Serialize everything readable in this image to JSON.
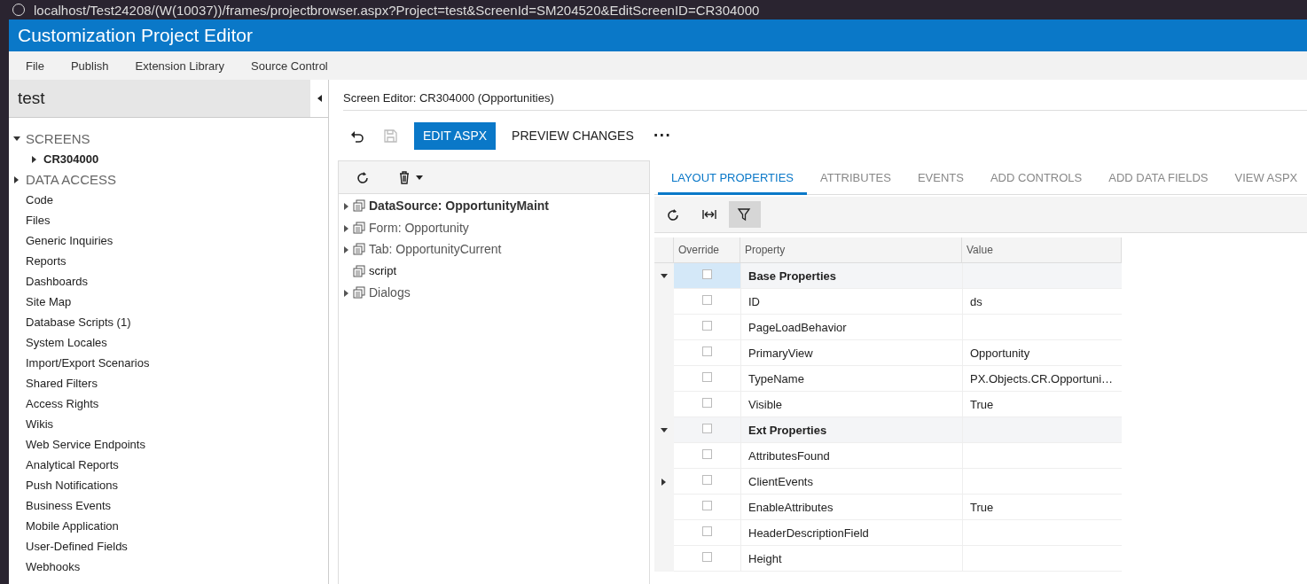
{
  "browser": {
    "address": "localhost/Test24208/(W(10037))/frames/projectbrowser.aspx?Project=test&ScreenId=SM204520&EditScreenID=CR304000"
  },
  "app_title": "Customization Project Editor",
  "menu": [
    "File",
    "Publish",
    "Extension Library",
    "Source Control"
  ],
  "sidebar": {
    "project": "test",
    "items": [
      {
        "label": "SCREENS",
        "kind": "section",
        "expanded": true,
        "children": [
          {
            "label": "CR304000",
            "kind": "node",
            "expanded": false
          }
        ]
      },
      {
        "label": "DATA ACCESS",
        "kind": "section",
        "expanded": false
      },
      {
        "label": "Code",
        "kind": "item"
      },
      {
        "label": "Files",
        "kind": "item"
      },
      {
        "label": "Generic Inquiries",
        "kind": "item"
      },
      {
        "label": "Reports",
        "kind": "item"
      },
      {
        "label": "Dashboards",
        "kind": "item"
      },
      {
        "label": "Site Map",
        "kind": "item"
      },
      {
        "label": "Database Scripts (1)",
        "kind": "item"
      },
      {
        "label": "System Locales",
        "kind": "item"
      },
      {
        "label": "Import/Export Scenarios",
        "kind": "item"
      },
      {
        "label": "Shared Filters",
        "kind": "item"
      },
      {
        "label": "Access Rights",
        "kind": "item"
      },
      {
        "label": "Wikis",
        "kind": "item"
      },
      {
        "label": "Web Service Endpoints",
        "kind": "item"
      },
      {
        "label": "Analytical Reports",
        "kind": "item"
      },
      {
        "label": "Push Notifications",
        "kind": "item"
      },
      {
        "label": "Business Events",
        "kind": "item"
      },
      {
        "label": "Mobile Application",
        "kind": "item"
      },
      {
        "label": "User-Defined Fields",
        "kind": "item"
      },
      {
        "label": "Webhooks",
        "kind": "item"
      }
    ]
  },
  "editor": {
    "title": "Screen Editor: CR304000 (Opportunities)",
    "toolbar": [
      {
        "kind": "undo",
        "disabled": false
      },
      {
        "kind": "save",
        "disabled": true
      },
      {
        "kind": "primary",
        "label": "EDIT ASPX"
      },
      {
        "kind": "text",
        "label": "PREVIEW CHANGES"
      },
      {
        "kind": "more",
        "label": "···"
      }
    ],
    "controls_tree": [
      {
        "label": "DataSource: OpportunityMaint",
        "kind": "bold",
        "expandable": true
      },
      {
        "label": "Form: Opportunity",
        "kind": "normal",
        "expandable": true
      },
      {
        "label": "Tab: OpportunityCurrent",
        "kind": "normal",
        "expandable": true
      },
      {
        "label": "script",
        "kind": "dark",
        "expandable": false
      },
      {
        "label": "Dialogs",
        "kind": "normal",
        "expandable": true
      }
    ],
    "tabs": [
      {
        "label": "LAYOUT PROPERTIES",
        "selected": true
      },
      {
        "label": "ATTRIBUTES",
        "selected": false
      },
      {
        "label": "EVENTS",
        "selected": false
      },
      {
        "label": "ADD CONTROLS",
        "selected": false
      },
      {
        "label": "ADD DATA FIELDS",
        "selected": false
      },
      {
        "label": "VIEW ASPX",
        "selected": false
      }
    ],
    "grid_toolbar": {
      "filter_on": true
    },
    "columns": [
      "Override",
      "Property",
      "Value"
    ],
    "rows": [
      {
        "kind": "group",
        "property": "Base Properties",
        "expandable": true,
        "expanded": true,
        "override": false,
        "selected": true
      },
      {
        "kind": "property",
        "property": "ID",
        "value": "ds",
        "expandable": false,
        "override": false,
        "selected": false
      },
      {
        "kind": "property",
        "property": "PageLoadBehavior",
        "expandable": false,
        "override": false,
        "selected": false
      },
      {
        "kind": "property",
        "property": "PrimaryView",
        "value": "Opportunity",
        "expandable": false,
        "override": false,
        "selected": false
      },
      {
        "kind": "property",
        "property": "TypeName",
        "value": "PX.Objects.CR.Opportuni…",
        "expandable": false,
        "override": false,
        "selected": false
      },
      {
        "kind": "property",
        "property": "Visible",
        "value": "True",
        "expandable": false,
        "override": false,
        "selected": false
      },
      {
        "kind": "group",
        "property": "Ext Properties",
        "expandable": true,
        "expanded": true,
        "override": false,
        "selected": false
      },
      {
        "kind": "property",
        "property": "AttributesFound",
        "expandable": false,
        "override": false,
        "selected": false
      },
      {
        "kind": "property",
        "property": "ClientEvents",
        "expandable": true,
        "expanded": false,
        "override": false,
        "selected": false
      },
      {
        "kind": "property",
        "property": "EnableAttributes",
        "value": "True",
        "expandable": false,
        "override": false,
        "selected": false
      },
      {
        "kind": "property",
        "property": "HeaderDescriptionField",
        "expandable": false,
        "override": false,
        "selected": false
      },
      {
        "kind": "property",
        "property": "Height",
        "expandable": false,
        "override": false,
        "selected": false
      }
    ]
  }
}
